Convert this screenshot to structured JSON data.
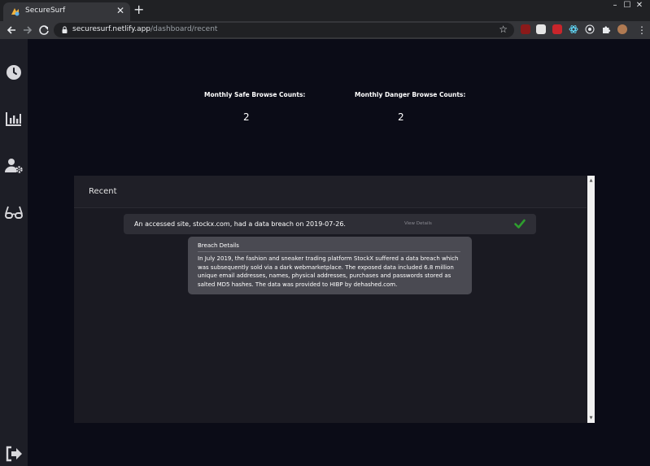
{
  "browser": {
    "tab_title": "SecureSurf",
    "tab_close": "✕",
    "new_tab": "+",
    "url_host": "securesurf.netlify.app",
    "url_path": "/dashboard/recent",
    "window_controls": [
      "–",
      "☐",
      "✕"
    ],
    "extension_icons": [
      "ublock-icon",
      "pocket-icon",
      "pdf-icon",
      "react-devtools-icon",
      "recorder-icon",
      "extensions-puzzle-icon",
      "profile-avatar"
    ]
  },
  "sidebar": {
    "items": [
      {
        "name": "history-icon",
        "label": "Recent"
      },
      {
        "name": "stats-chart-icon",
        "label": "Statistics"
      },
      {
        "name": "user-settings-icon",
        "label": "Account Settings"
      },
      {
        "name": "glasses-icon",
        "label": "Browse Monitor"
      },
      {
        "name": "logout-icon",
        "label": "Sign Out"
      }
    ]
  },
  "stats": {
    "safe_label": "Monthly Safe Browse Counts:",
    "safe_value": "2",
    "danger_label": "Monthly Danger Browse Counts:",
    "danger_value": "2"
  },
  "recent": {
    "title": "Recent",
    "alert_text": "An accessed site, stockx.com, had a data breach on 2019-07-26.",
    "view_details": "View Details",
    "tooltip_title": "Breach Details",
    "tooltip_body": "In July 2019, the fashion and sneaker trading platform StockX suffered a data breach which was subsequently sold via a dark webmarketplace. The exposed data included 6.8 million unique email addresses, names, physical addresses, purchases and passwords stored as salted MD5 hashes. The data was provided to HIBP by dehashed.com."
  },
  "colors": {
    "background": "#0b0c17",
    "sidebar": "#1d1e26",
    "panel": "#1a1a22",
    "check_green": "#2e9e2e"
  }
}
